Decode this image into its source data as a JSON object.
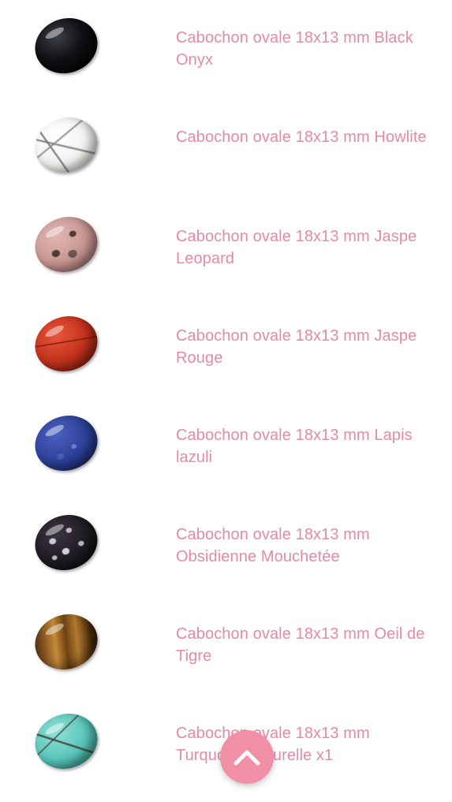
{
  "products": [
    {
      "title": "Cabochon ovale 18x13 mm Black Onyx",
      "stone_color": "#101014",
      "stone_accent": "#2a2d33"
    },
    {
      "title": "Cabochon ovale 18x13 mm Howlite",
      "stone_color": "#f1f1ee",
      "stone_accent": "#6b6b6b"
    },
    {
      "title": "Cabochon ovale 18x13 mm Jaspe Leopard",
      "stone_color": "#c79490",
      "stone_accent": "#5a3f3a"
    },
    {
      "title": "Cabochon ovale 18x13 mm Jaspe Rouge",
      "stone_color": "#c4321d",
      "stone_accent": "#7a1a0e"
    },
    {
      "title": "Cabochon ovale 18x13 mm Lapis lazuli",
      "stone_color": "#2c3f96",
      "stone_accent": "#17245c"
    },
    {
      "title": "Cabochon ovale 18x13 mm Obsidienne Mouchetée",
      "stone_color": "#1e1a22",
      "stone_accent": "#b9b8c4"
    },
    {
      "title": "Cabochon ovale 18x13 mm Oeil de Tigre",
      "stone_color": "#8a5720",
      "stone_accent": "#3a2208"
    },
    {
      "title": "Cabochon ovale 18x13 mm Turquoise naturelle x1",
      "stone_color": "#57c3b8",
      "stone_accent": "#3a3a30"
    }
  ],
  "scroll_top_button": {
    "icon": "chevron-up-icon",
    "color": "#f08fa6"
  }
}
